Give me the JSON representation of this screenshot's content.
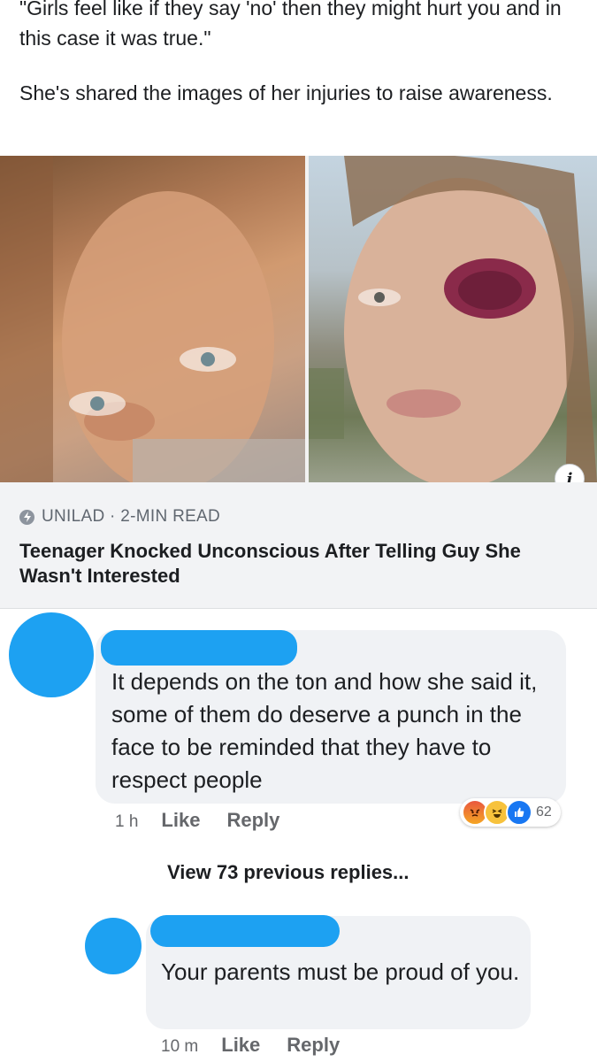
{
  "post": {
    "paragraph_1": "\"Girls feel like if they say 'no' then they might hurt you and in this case it was true.\"",
    "paragraph_2": "She's shared the images of her injuries to raise awareness."
  },
  "link_card": {
    "source": "UNILAD · 2-MIN READ",
    "title": "Teenager Knocked Unconscious After Telling Guy She Wasn't Interested",
    "info_glyph": "i"
  },
  "comments": [
    {
      "text": "It depends on the ton and how she said it, some of them do deserve a punch in the face to be reminded that they have to respect people",
      "time": "1 h",
      "like_label": "Like",
      "reply_label": "Reply",
      "reactions": [
        "angry-icon",
        "haha-icon",
        "like-icon"
      ],
      "reaction_count": "62"
    },
    {
      "text": "Your parents must be proud of you.",
      "time": "10 m",
      "like_label": "Like",
      "reply_label": "Reply"
    }
  ],
  "view_replies_label": "View 73 previous replies...",
  "colors": {
    "redaction": "#1da1f2",
    "bubble": "#f0f2f5",
    "card": "#f2f3f5"
  }
}
